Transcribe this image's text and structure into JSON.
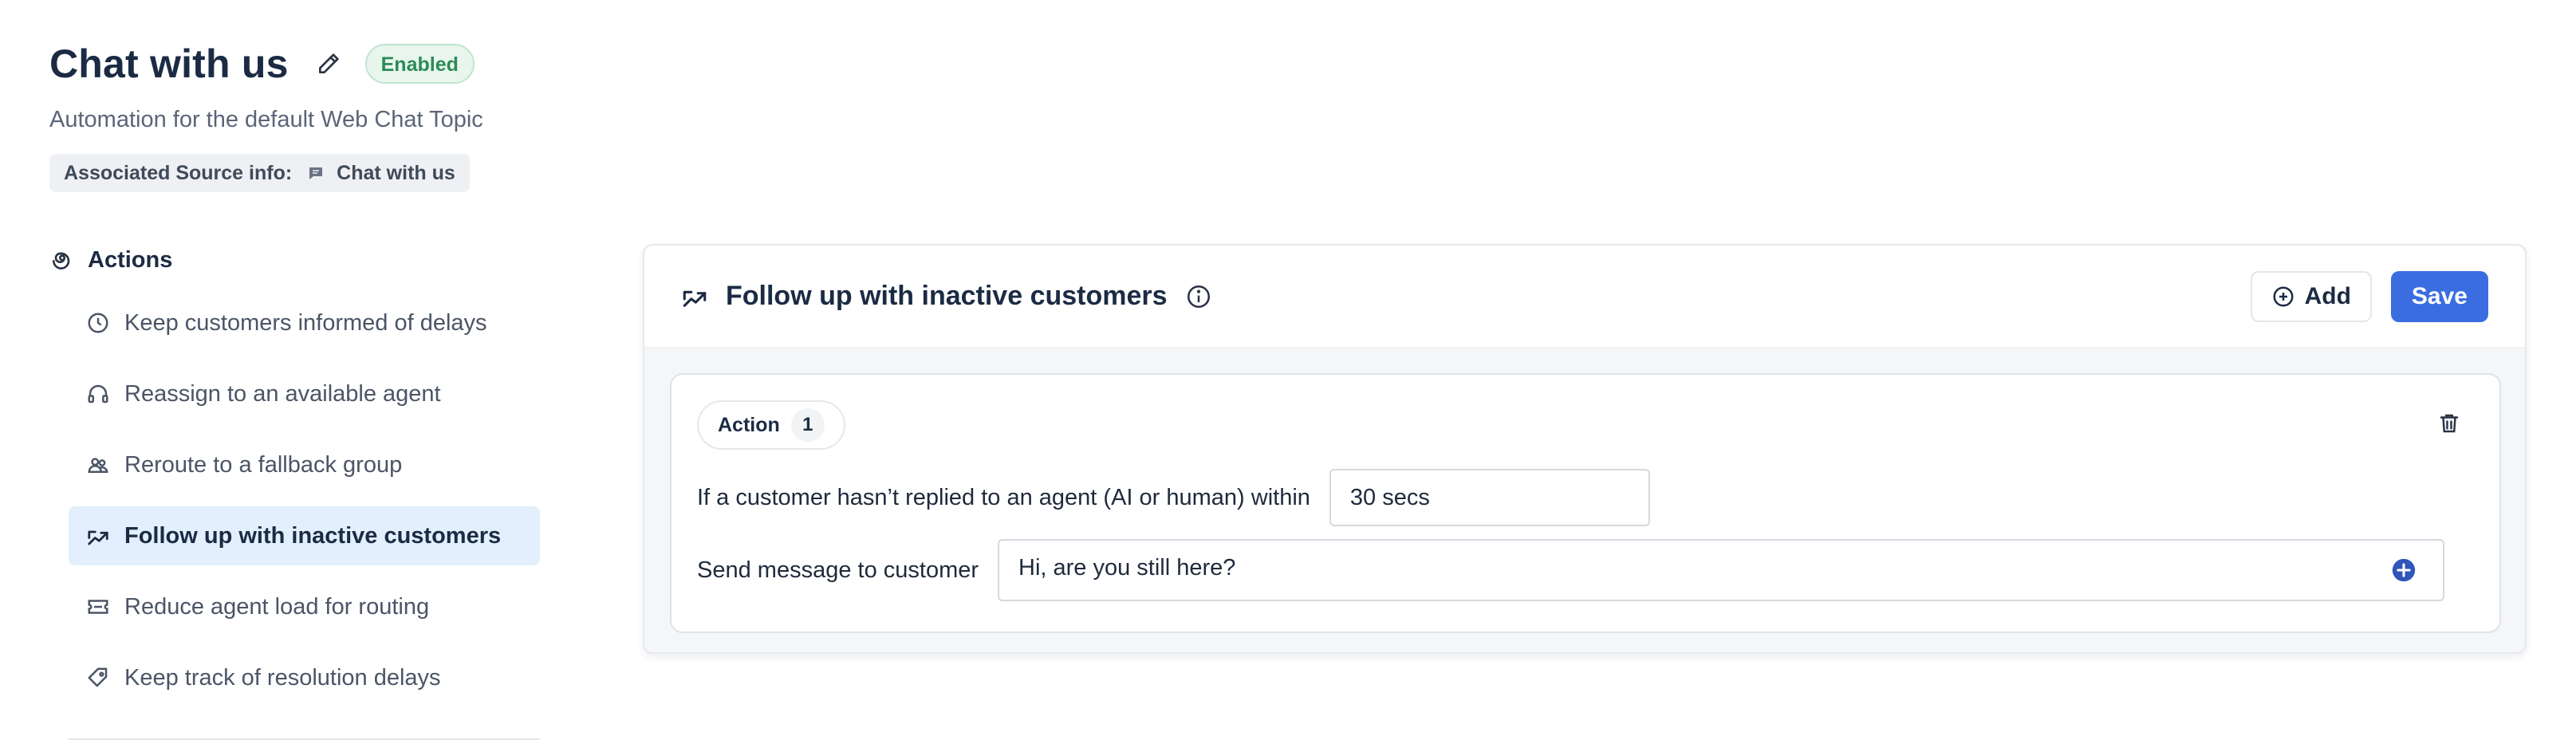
{
  "header": {
    "title": "Chat with us",
    "status": "Enabled",
    "subtitle": "Automation for the default Web Chat Topic",
    "source_label": "Associated Source info:",
    "source_value": "Chat with us"
  },
  "sidebar": {
    "heading": "Actions",
    "items": [
      {
        "label": "Keep customers informed of delays",
        "icon": "clock-icon"
      },
      {
        "label": "Reassign to an available agent",
        "icon": "headset-icon"
      },
      {
        "label": "Reroute to a fallback group",
        "icon": "group-icon"
      },
      {
        "label": "Follow up with inactive customers",
        "icon": "trend-arrows-icon",
        "active": true
      },
      {
        "label": "Reduce agent load for routing",
        "icon": "ticket-icon"
      },
      {
        "label": "Keep track of resolution delays",
        "icon": "tag-icon"
      }
    ]
  },
  "card": {
    "title": "Follow up with inactive customers",
    "add_label": "Add",
    "save_label": "Save",
    "action": {
      "label": "Action",
      "number": "1",
      "condition_label": "If a customer hasn’t replied to an agent (AI or human) within",
      "condition_value": "30 secs",
      "message_label": "Send message to customer",
      "message_value": "Hi, are you still here?"
    }
  },
  "colors": {
    "accent": "#3a6de0",
    "active_bg": "#e3effc",
    "enabled_bg": "#e8f6ee",
    "enabled_text": "#2d8a57"
  }
}
